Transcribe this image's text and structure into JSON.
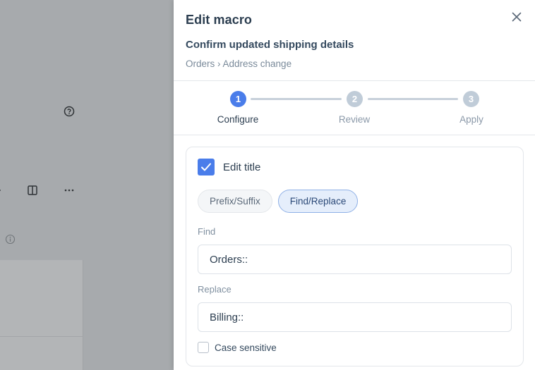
{
  "drawer": {
    "title": "Edit macro",
    "subtitle": "Confirm updated shipping details",
    "breadcrumb": "Orders › Address change"
  },
  "stepper": {
    "steps": [
      {
        "number": "1",
        "label": "Configure",
        "state": "active"
      },
      {
        "number": "2",
        "label": "Review",
        "state": "inactive"
      },
      {
        "number": "3",
        "label": "Apply",
        "state": "inactive"
      }
    ]
  },
  "form": {
    "edit_title": {
      "label": "Edit title",
      "checked": true
    },
    "modes": [
      {
        "label": "Prefix/Suffix",
        "selected": false
      },
      {
        "label": "Find/Replace",
        "selected": true
      }
    ],
    "find": {
      "label": "Find",
      "value": "Orders::"
    },
    "replace": {
      "label": "Replace",
      "value": "Billing::"
    },
    "case_sensitive": {
      "label": "Case sensitive",
      "checked": false
    }
  },
  "colors": {
    "accent": "#4a7dea",
    "overlay": "#a7aaad",
    "text_primary": "#2c3e50",
    "text_muted": "#8090a0"
  },
  "icons": {
    "close": "close-icon",
    "check": "check-icon",
    "help": "help-circle-icon",
    "columns": "columns-icon",
    "more": "more-horizontal-icon",
    "info": "info-icon"
  }
}
